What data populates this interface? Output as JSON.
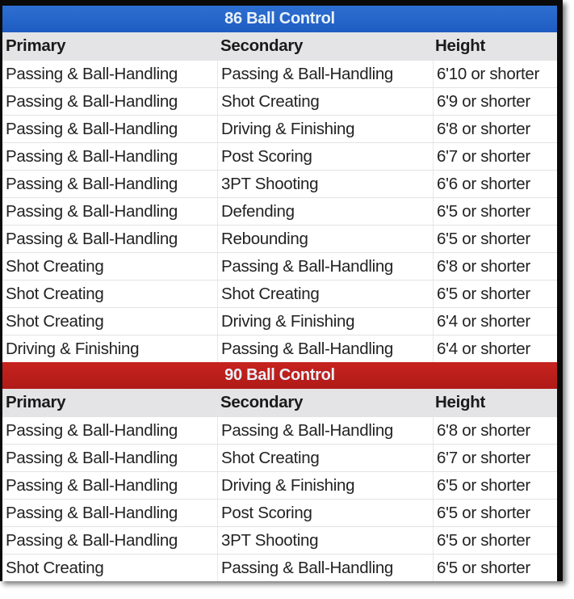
{
  "tables": [
    {
      "title": "86 Ball Control",
      "accent": "#2563c8",
      "headers": [
        "Primary",
        "Secondary",
        "Height"
      ],
      "rows": [
        [
          "Passing & Ball-Handling",
          "Passing & Ball-Handling",
          "6'10 or shorter"
        ],
        [
          "Passing & Ball-Handling",
          "Shot Creating",
          "6'9 or shorter"
        ],
        [
          "Passing & Ball-Handling",
          "Driving & Finishing",
          "6'8 or shorter"
        ],
        [
          "Passing & Ball-Handling",
          "Post Scoring",
          "6'7 or shorter"
        ],
        [
          "Passing & Ball-Handling",
          "3PT Shooting",
          "6'6 or shorter"
        ],
        [
          "Passing & Ball-Handling",
          "Defending",
          "6'5 or shorter"
        ],
        [
          "Passing & Ball-Handling",
          "Rebounding",
          "6'5 or shorter"
        ],
        [
          "Shot Creating",
          "Passing & Ball-Handling",
          "6'8 or shorter"
        ],
        [
          "Shot Creating",
          "Shot Creating",
          "6'5 or shorter"
        ],
        [
          "Shot Creating",
          "Driving & Finishing",
          "6'4 or shorter"
        ],
        [
          "Driving & Finishing",
          "Passing & Ball-Handling",
          "6'4 or shorter"
        ]
      ]
    },
    {
      "title": "90 Ball Control",
      "accent": "#be201c",
      "headers": [
        "Primary",
        "Secondary",
        "Height"
      ],
      "rows": [
        [
          "Passing & Ball-Handling",
          "Passing & Ball-Handling",
          "6'8 or shorter"
        ],
        [
          "Passing & Ball-Handling",
          "Shot Creating",
          "6'7 or shorter"
        ],
        [
          "Passing & Ball-Handling",
          "Driving & Finishing",
          "6'5 or shorter"
        ],
        [
          "Passing & Ball-Handling",
          "Post Scoring",
          "6'5 or shorter"
        ],
        [
          "Passing & Ball-Handling",
          "3PT Shooting",
          "6'5 or shorter"
        ],
        [
          "Shot Creating",
          "Passing & Ball-Handling",
          "6'5 or shorter"
        ]
      ]
    }
  ]
}
